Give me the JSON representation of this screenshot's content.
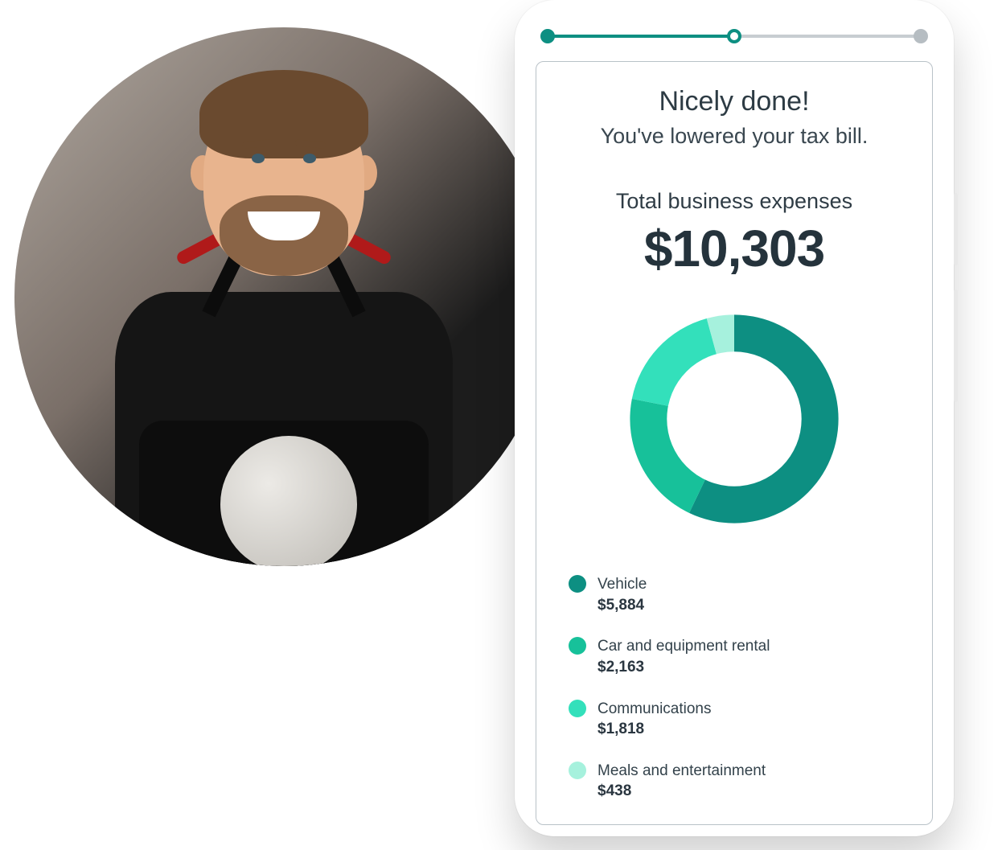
{
  "header": {
    "title": "Nicely done!",
    "subtitle": "You've lowered your tax bill."
  },
  "summary": {
    "label": "Total business expenses",
    "value": "$10,303"
  },
  "progress": {
    "steps": 3,
    "current": 2,
    "fill_percent": 50
  },
  "colors": {
    "accent": "#0d8f82",
    "track": "#c7cdd1"
  },
  "legend": [
    {
      "label": "Vehicle",
      "value": "$5,884",
      "color": "#0d8f82"
    },
    {
      "label": "Car and equipment rental",
      "value": "$2,163",
      "color": "#17c19a"
    },
    {
      "label": "Communications",
      "value": "$1,818",
      "color": "#33e0bb"
    },
    {
      "label": "Meals and entertainment",
      "value": "$438",
      "color": "#a6f1dd"
    }
  ],
  "chart_data": {
    "type": "pie",
    "title": "Total business expenses",
    "series": [
      {
        "name": "Vehicle",
        "value": 5884,
        "color": "#0d8f82"
      },
      {
        "name": "Car and equipment rental",
        "value": 2163,
        "color": "#17c19a"
      },
      {
        "name": "Communications",
        "value": 1818,
        "color": "#33e0bb"
      },
      {
        "name": "Meals and entertainment",
        "value": 438,
        "color": "#a6f1dd"
      }
    ],
    "total": 10303,
    "donut_inner_ratio": 0.62
  }
}
